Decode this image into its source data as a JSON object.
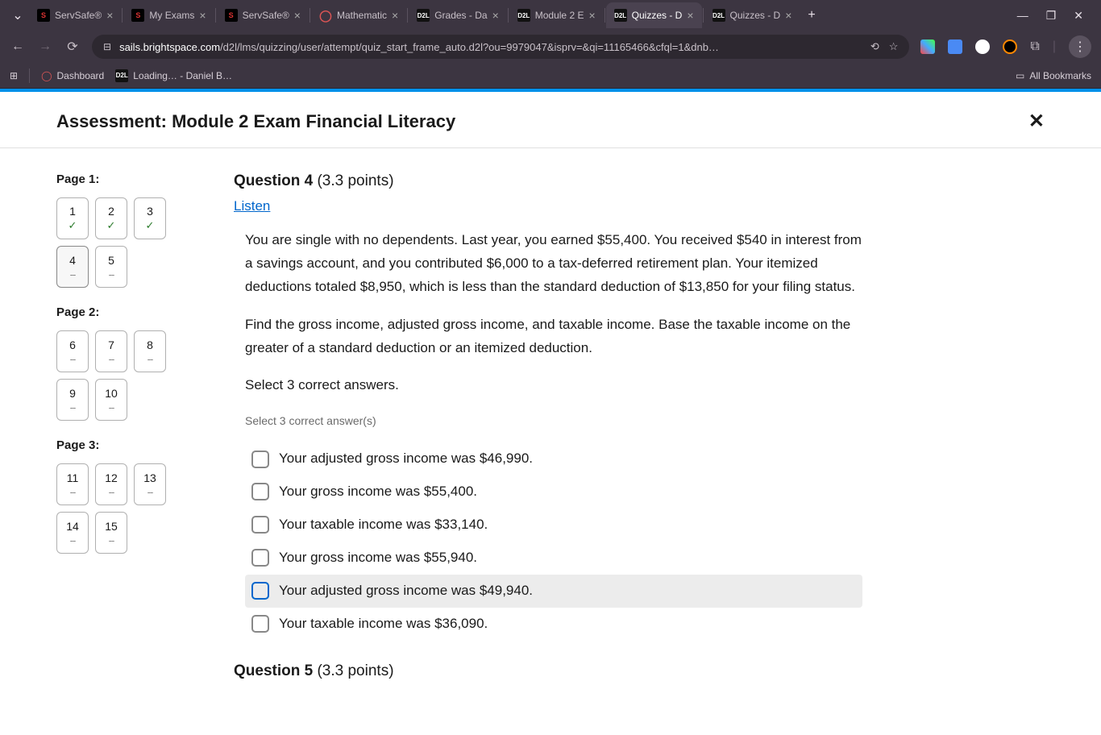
{
  "browser": {
    "tabs": [
      {
        "title": "ServSafe®",
        "fav": "s"
      },
      {
        "title": "My Exams",
        "fav": "s"
      },
      {
        "title": "ServSafe®",
        "fav": "s"
      },
      {
        "title": "Mathematic",
        "fav": "o"
      },
      {
        "title": "Grades - Da",
        "fav": "d"
      },
      {
        "title": "Module 2 E",
        "fav": "d"
      },
      {
        "title": "Quizzes - D",
        "fav": "d",
        "active": true
      },
      {
        "title": "Quizzes - D",
        "fav": "d"
      }
    ],
    "url_domain": "sails.brightspace.com",
    "url_path": "/d2l/lms/quizzing/user/attempt/quiz_start_frame_auto.d2l?ou=9979047&isprv=&qi=11165466&cfql=1&dnb…",
    "bookmarks": {
      "dashboard": "Dashboard",
      "loading": "Loading… - Daniel B…",
      "all": "All Bookmarks"
    }
  },
  "assessment": {
    "title": "Assessment: Module 2 Exam Financial Literacy"
  },
  "sidebar": {
    "pages": [
      {
        "label": "Page 1:",
        "questions": [
          {
            "n": "1",
            "status": "check"
          },
          {
            "n": "2",
            "status": "check"
          },
          {
            "n": "3",
            "status": "check"
          },
          {
            "n": "4",
            "status": "dash",
            "current": true
          },
          {
            "n": "5",
            "status": "dash"
          }
        ]
      },
      {
        "label": "Page 2:",
        "questions": [
          {
            "n": "6",
            "status": "dash"
          },
          {
            "n": "7",
            "status": "dash"
          },
          {
            "n": "8",
            "status": "dash"
          },
          {
            "n": "9",
            "status": "dash"
          },
          {
            "n": "10",
            "status": "dash"
          }
        ]
      },
      {
        "label": "Page 3:",
        "questions": [
          {
            "n": "11",
            "status": "dash"
          },
          {
            "n": "12",
            "status": "dash"
          },
          {
            "n": "13",
            "status": "dash"
          },
          {
            "n": "14",
            "status": "dash"
          },
          {
            "n": "15",
            "status": "dash"
          }
        ]
      }
    ]
  },
  "question": {
    "number": "Question 4",
    "points": "(3.3 points)",
    "listen": "Listen",
    "para1": "You are single with no dependents. Last year, you earned $55,400. You received $540 in interest from a savings account, and you contributed $6,000 to a tax-deferred retirement plan. Your itemized deductions totaled $8,950, which is less than the standard deduction of $13,850 for your filing status.",
    "para2": "Find the gross income, adjusted gross income, and taxable income. Base the taxable income on the greater of a standard deduction or an itemized deduction.",
    "para3": "Select 3 correct answers.",
    "hint": "Select 3 correct answer(s)",
    "answers": [
      "Your adjusted gross income was $46,990.",
      "Your gross income was $55,400.",
      "Your taxable income was $33,140.",
      "Your gross income was $55,940.",
      "Your adjusted gross income was $49,940.",
      "Your taxable income was $36,090."
    ],
    "next_number": "Question 5",
    "next_points": "(3.3 points)"
  }
}
